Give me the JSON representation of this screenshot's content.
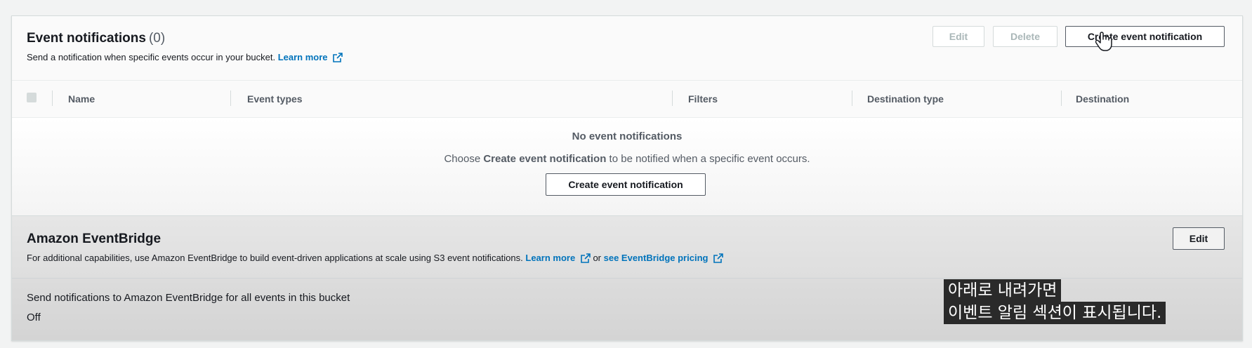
{
  "notifications": {
    "title": "Event notifications",
    "count": "(0)",
    "description": "Send a notification when specific events occur in your bucket.",
    "learn_more": "Learn more",
    "buttons": {
      "edit": "Edit",
      "delete": "Delete",
      "create": "Create event notification"
    },
    "columns": [
      "Name",
      "Event types",
      "Filters",
      "Destination type",
      "Destination"
    ],
    "empty": {
      "title": "No event notifications",
      "prefix": "Choose",
      "emphasis": "Create event notification",
      "suffix": "to be notified when a specific event occurs.",
      "button": "Create event notification"
    }
  },
  "eventbridge": {
    "title": "Amazon EventBridge",
    "description": "For additional capabilities, use Amazon EventBridge to build event-driven applications at scale using S3 event notifications.",
    "learn_more": "Learn more",
    "or": "or",
    "pricing_link": "see EventBridge pricing",
    "edit": "Edit",
    "setting_label": "Send notifications to Amazon EventBridge for all events in this bucket",
    "setting_value": "Off"
  },
  "subtitle": {
    "line1": "아래로 내려가면",
    "line2": "이벤트 알림 섹션이 표시됩니다."
  },
  "icons": [
    "external-link-icon",
    "checkbox-icon",
    "hand-cursor-icon"
  ],
  "colors": {
    "link": "#0073bb",
    "text": "#16191f",
    "muted": "#545b64",
    "disabled": "#aab7b8"
  }
}
